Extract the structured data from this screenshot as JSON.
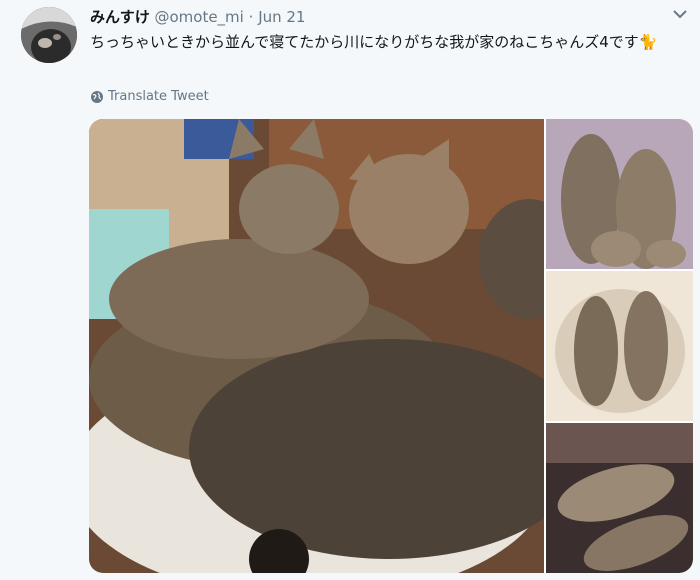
{
  "tweet": {
    "display_name": "みんすけ",
    "handle": "@omote_mi",
    "separator": "·",
    "date": "Jun 21",
    "text": "ちっちゃいときから並んで寝てたから川になりがちな我が家のねこちゃんズ4です🐈",
    "translate_label": "Translate Tweet"
  },
  "icons": {
    "caret": "chevron-down-icon",
    "translate": "globe-icon"
  },
  "colors": {
    "background": "#f5f8fa",
    "secondary_text": "#657786",
    "primary_text": "#14171a"
  }
}
